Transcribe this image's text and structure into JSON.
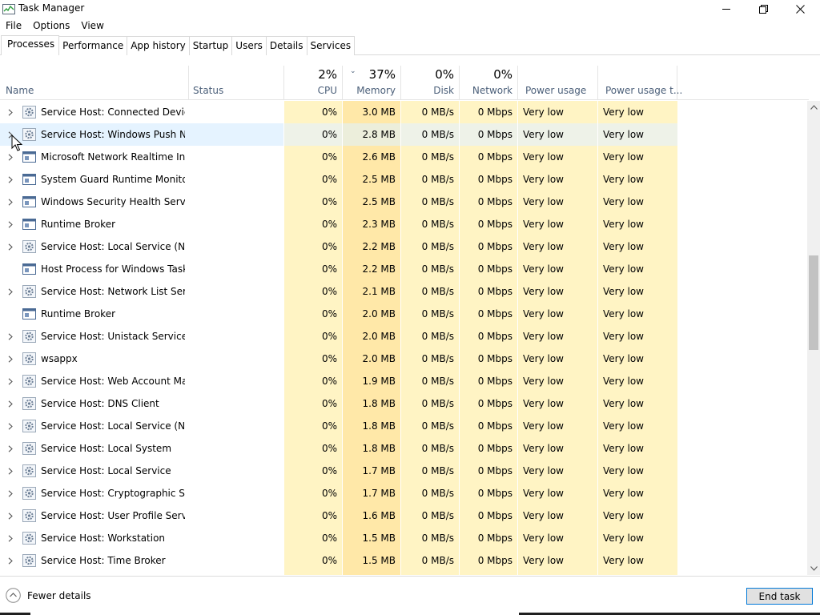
{
  "window": {
    "title": "Task Manager",
    "icon": "task-manager-icon"
  },
  "menu": [
    "File",
    "Options",
    "View"
  ],
  "tabs": [
    {
      "label": "Processes",
      "active": true
    },
    {
      "label": "Performance",
      "active": false
    },
    {
      "label": "App history",
      "active": false
    },
    {
      "label": "Startup",
      "active": false
    },
    {
      "label": "Users",
      "active": false
    },
    {
      "label": "Details",
      "active": false
    },
    {
      "label": "Services",
      "active": false
    }
  ],
  "columns": {
    "name": {
      "label": "Name"
    },
    "status": {
      "label": "Status"
    },
    "cpu": {
      "label": "CPU",
      "percent": "2%"
    },
    "memory": {
      "label": "Memory",
      "percent": "37%"
    },
    "disk": {
      "label": "Disk",
      "percent": "0%"
    },
    "network": {
      "label": "Network",
      "percent": "0%"
    },
    "power": {
      "label": "Power usage"
    },
    "power_trend": {
      "label": "Power usage t..."
    }
  },
  "processes": [
    {
      "name": "Service Host: Connected Device...",
      "icon": "gear-icon",
      "expandable": true,
      "cpu": "0%",
      "memory": "3.0 MB",
      "disk": "0 MB/s",
      "network": "0 Mbps",
      "power": "Very low",
      "power_trend": "Very low"
    },
    {
      "name": "Service Host: Windows Push No...",
      "icon": "gear-icon",
      "expandable": true,
      "cpu": "0%",
      "memory": "2.8 MB",
      "disk": "0 MB/s",
      "network": "0 Mbps",
      "power": "Very low",
      "power_trend": "Very low"
    },
    {
      "name": "Microsoft Network Realtime Ins...",
      "icon": "window-icon",
      "expandable": true,
      "cpu": "0%",
      "memory": "2.6 MB",
      "disk": "0 MB/s",
      "network": "0 Mbps",
      "power": "Very low",
      "power_trend": "Very low"
    },
    {
      "name": "System Guard Runtime Monitor...",
      "icon": "window-icon",
      "expandable": true,
      "cpu": "0%",
      "memory": "2.5 MB",
      "disk": "0 MB/s",
      "network": "0 Mbps",
      "power": "Very low",
      "power_trend": "Very low"
    },
    {
      "name": "Windows Security Health Service",
      "icon": "window-icon",
      "expandable": true,
      "cpu": "0%",
      "memory": "2.5 MB",
      "disk": "0 MB/s",
      "network": "0 Mbps",
      "power": "Very low",
      "power_trend": "Very low"
    },
    {
      "name": "Runtime Broker",
      "icon": "window-icon",
      "expandable": true,
      "cpu": "0%",
      "memory": "2.3 MB",
      "disk": "0 MB/s",
      "network": "0 Mbps",
      "power": "Very low",
      "power_trend": "Very low"
    },
    {
      "name": "Service Host: Local Service (Net...",
      "icon": "gear-icon",
      "expandable": true,
      "cpu": "0%",
      "memory": "2.2 MB",
      "disk": "0 MB/s",
      "network": "0 Mbps",
      "power": "Very low",
      "power_trend": "Very low"
    },
    {
      "name": "Host Process for Windows Tasks",
      "icon": "window-icon",
      "expandable": false,
      "cpu": "0%",
      "memory": "2.2 MB",
      "disk": "0 MB/s",
      "network": "0 Mbps",
      "power": "Very low",
      "power_trend": "Very low"
    },
    {
      "name": "Service Host: Network List Service",
      "icon": "gear-icon",
      "expandable": true,
      "cpu": "0%",
      "memory": "2.1 MB",
      "disk": "0 MB/s",
      "network": "0 Mbps",
      "power": "Very low",
      "power_trend": "Very low"
    },
    {
      "name": "Runtime Broker",
      "icon": "window-icon",
      "expandable": false,
      "cpu": "0%",
      "memory": "2.0 MB",
      "disk": "0 MB/s",
      "network": "0 Mbps",
      "power": "Very low",
      "power_trend": "Very low"
    },
    {
      "name": "Service Host: Unistack Service G...",
      "icon": "gear-icon",
      "expandable": true,
      "cpu": "0%",
      "memory": "2.0 MB",
      "disk": "0 MB/s",
      "network": "0 Mbps",
      "power": "Very low",
      "power_trend": "Very low"
    },
    {
      "name": "wsappx",
      "icon": "gear-icon",
      "expandable": true,
      "cpu": "0%",
      "memory": "2.0 MB",
      "disk": "0 MB/s",
      "network": "0 Mbps",
      "power": "Very low",
      "power_trend": "Very low"
    },
    {
      "name": "Service Host: Web Account Ma...",
      "icon": "gear-icon",
      "expandable": true,
      "cpu": "0%",
      "memory": "1.9 MB",
      "disk": "0 MB/s",
      "network": "0 Mbps",
      "power": "Very low",
      "power_trend": "Very low"
    },
    {
      "name": "Service Host: DNS Client",
      "icon": "gear-icon",
      "expandable": true,
      "cpu": "0%",
      "memory": "1.8 MB",
      "disk": "0 MB/s",
      "network": "0 Mbps",
      "power": "Very low",
      "power_trend": "Very low"
    },
    {
      "name": "Service Host: Local Service (Net...",
      "icon": "gear-icon",
      "expandable": true,
      "cpu": "0%",
      "memory": "1.8 MB",
      "disk": "0 MB/s",
      "network": "0 Mbps",
      "power": "Very low",
      "power_trend": "Very low"
    },
    {
      "name": "Service Host: Local System",
      "icon": "gear-icon",
      "expandable": true,
      "cpu": "0%",
      "memory": "1.8 MB",
      "disk": "0 MB/s",
      "network": "0 Mbps",
      "power": "Very low",
      "power_trend": "Very low"
    },
    {
      "name": "Service Host: Local Service",
      "icon": "gear-icon",
      "expandable": true,
      "cpu": "0%",
      "memory": "1.7 MB",
      "disk": "0 MB/s",
      "network": "0 Mbps",
      "power": "Very low",
      "power_trend": "Very low"
    },
    {
      "name": "Service Host: Cryptographic Ser...",
      "icon": "gear-icon",
      "expandable": true,
      "cpu": "0%",
      "memory": "1.7 MB",
      "disk": "0 MB/s",
      "network": "0 Mbps",
      "power": "Very low",
      "power_trend": "Very low"
    },
    {
      "name": "Service Host: User Profile Service",
      "icon": "gear-icon",
      "expandable": true,
      "cpu": "0%",
      "memory": "1.6 MB",
      "disk": "0 MB/s",
      "network": "0 Mbps",
      "power": "Very low",
      "power_trend": "Very low"
    },
    {
      "name": "Service Host: Workstation",
      "icon": "gear-icon",
      "expandable": true,
      "cpu": "0%",
      "memory": "1.5 MB",
      "disk": "0 MB/s",
      "network": "0 Mbps",
      "power": "Very low",
      "power_trend": "Very low"
    },
    {
      "name": "Service Host: Time Broker",
      "icon": "gear-icon",
      "expandable": true,
      "cpu": "0%",
      "memory": "1.5 MB",
      "disk": "0 MB/s",
      "network": "0 Mbps",
      "power": "Very low",
      "power_trend": "Very low"
    }
  ],
  "footer": {
    "fewer_details": "Fewer details",
    "end_task": "End task"
  },
  "colors": {
    "column_fill": "#fff4c4",
    "memory_fill": "#ffe8a8",
    "selection": "#e5f3ff",
    "accent": "#0078d7",
    "header_text": "#4c607a"
  }
}
